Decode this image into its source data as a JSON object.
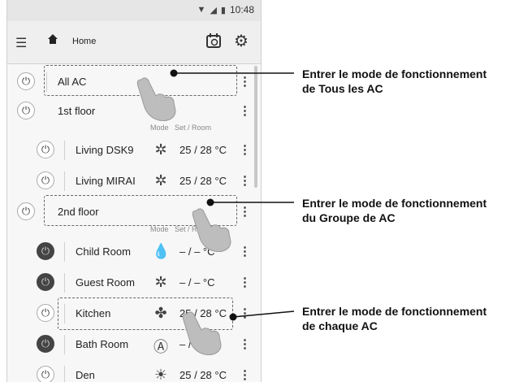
{
  "status": {
    "time": "10:48"
  },
  "appbar": {
    "title": "Home"
  },
  "columns": {
    "mode": "Mode",
    "set_room": "Set / Room"
  },
  "rows": [
    {
      "label": "All AC",
      "temp": ""
    },
    {
      "label": "1st floor",
      "temp": ""
    },
    {
      "label": "Living DSK9",
      "temp": "25 / 28 °C"
    },
    {
      "label": "Living MIRAI",
      "temp": "25 / 28 °C"
    },
    {
      "label": "2nd floor",
      "temp": ""
    },
    {
      "label": "Child Room",
      "temp": "– / –  °C"
    },
    {
      "label": "Guest Room",
      "temp": "– / –  °C"
    },
    {
      "label": "Kitchen",
      "temp": "25 / 28 °C"
    },
    {
      "label": "Bath Room",
      "temp": "– / –  °C"
    },
    {
      "label": "Den",
      "temp": "25 / 28 °C"
    }
  ],
  "callouts": [
    {
      "line1": "Entrer le mode de fonctionnement",
      "line2": "de Tous les AC"
    },
    {
      "line1": "Entrer le mode de fonctionnement",
      "line2": "du Groupe de AC"
    },
    {
      "line1": "Entrer le mode de fonctionnement",
      "line2": "de chaque AC"
    }
  ]
}
